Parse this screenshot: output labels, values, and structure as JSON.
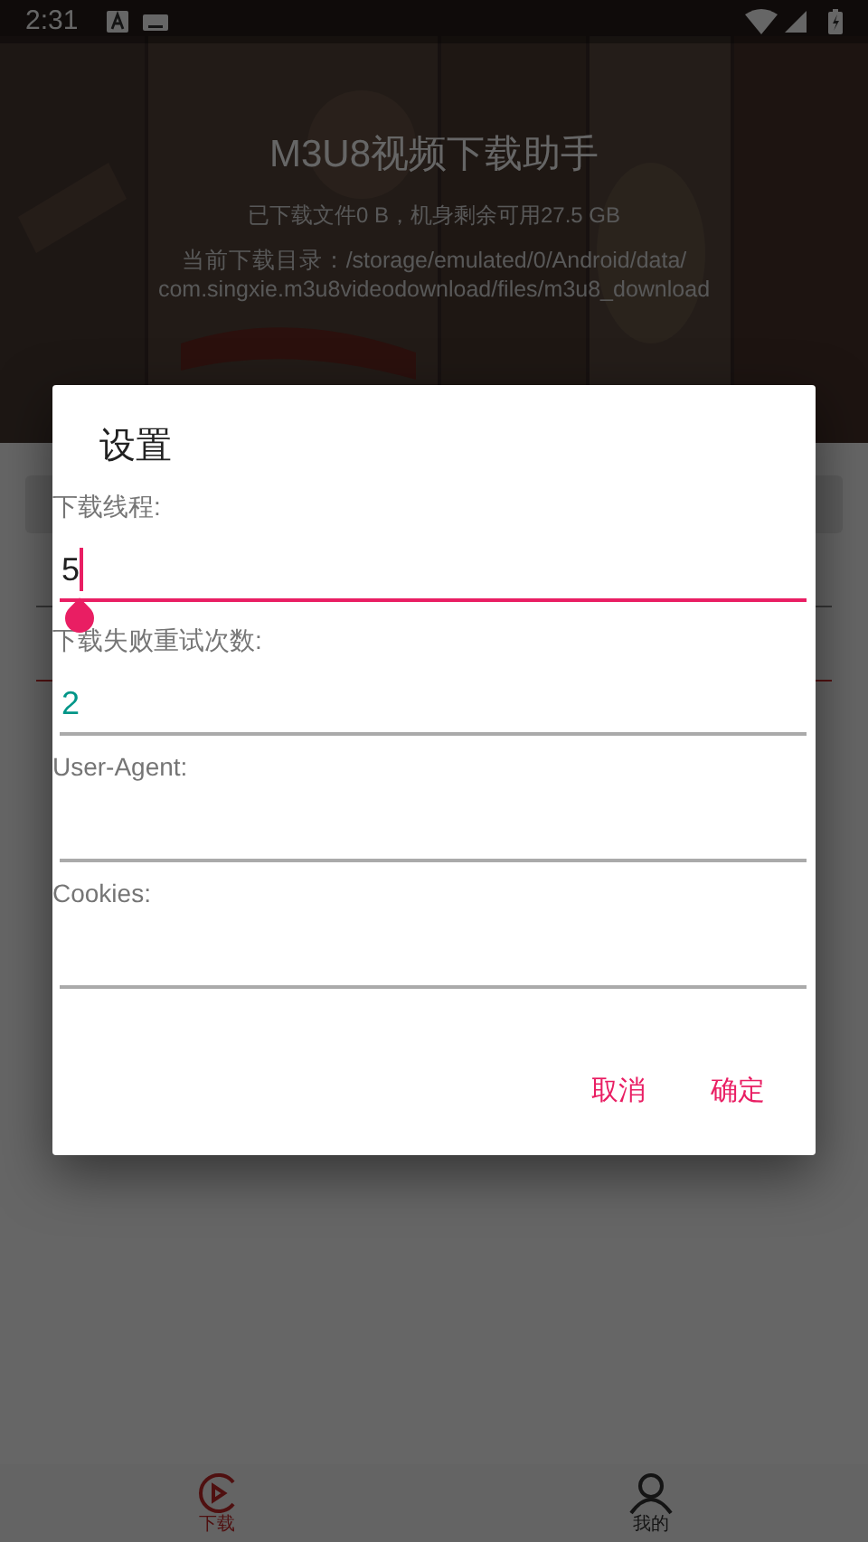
{
  "status_bar": {
    "time": "2:31"
  },
  "header": {
    "title": "M3U8视频下载助手",
    "storage": "已下载文件0 B，机身剩余可用27.5 GB",
    "directory_lines": [
      "当前下载目录：/storage/emulated/0/Android/data/",
      "com.singxie.m3u8videodownload/files/m3u8_download"
    ]
  },
  "dialog": {
    "title": "设置",
    "fields": [
      {
        "label": "下载线程:",
        "value": "5",
        "focused": true
      },
      {
        "label": "下载失败重试次数:",
        "value": "2",
        "focused": false
      },
      {
        "label": "User-Agent:",
        "focused": false
      },
      {
        "label": "Cookies:",
        "focused": false
      }
    ],
    "buttons": [
      "取消",
      "确定"
    ]
  },
  "bottom_nav": [
    {
      "label": "下载",
      "selected": true
    },
    {
      "label": "我的",
      "selected": false
    }
  ]
}
